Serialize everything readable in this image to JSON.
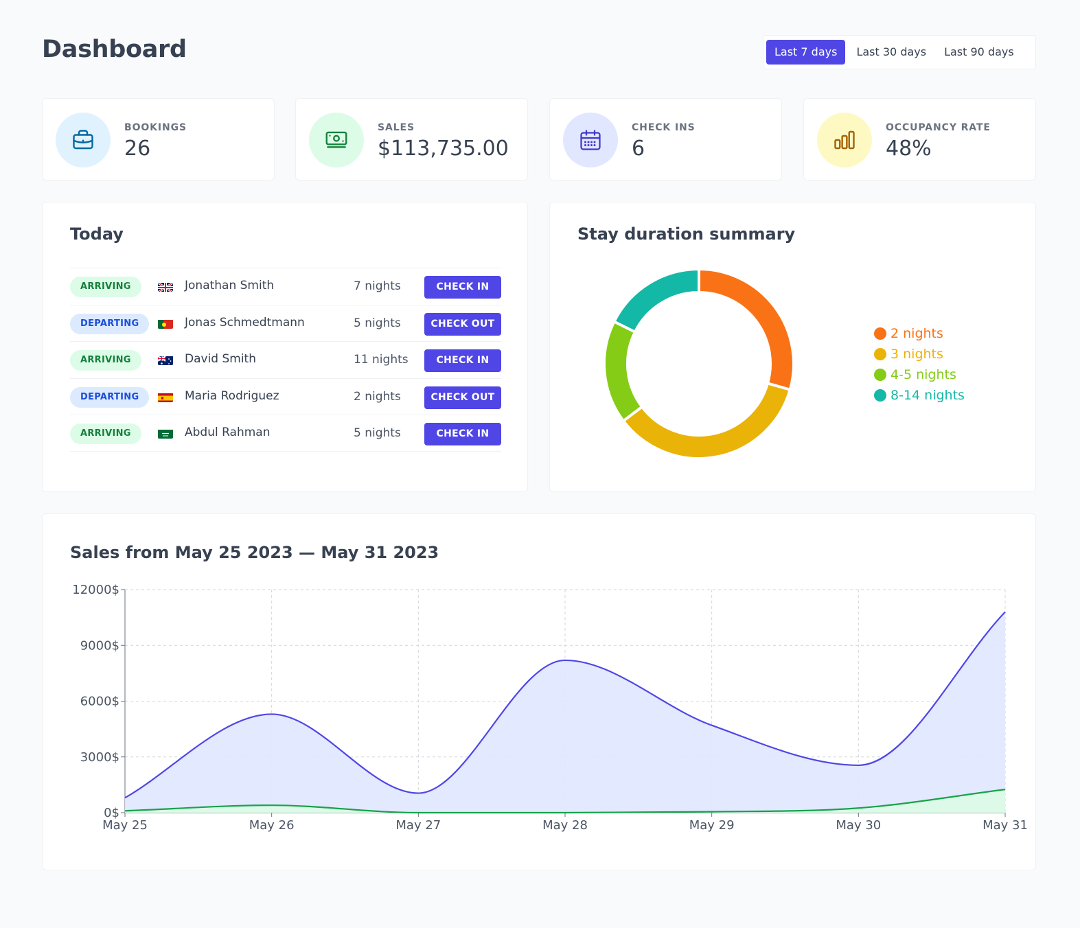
{
  "header": {
    "title": "Dashboard",
    "ranges": [
      "Last 7 days",
      "Last 30 days",
      "Last 90 days"
    ],
    "selected_range": "Last 7 days"
  },
  "stats": [
    {
      "label": "BOOKINGS",
      "value": "26",
      "icon": "briefcase-icon",
      "bg": "#e0f2fe",
      "color": "#0369a1"
    },
    {
      "label": "SALES",
      "value": "$113,735.00",
      "icon": "banknote-icon",
      "bg": "#dcfce7",
      "color": "#15803d"
    },
    {
      "label": "CHECK INS",
      "value": "6",
      "icon": "calendar-icon",
      "bg": "#e0e7ff",
      "color": "#4338ca"
    },
    {
      "label": "OCCUPANCY RATE",
      "value": "48%",
      "icon": "bar-chart-icon",
      "bg": "#fef9c3",
      "color": "#a16207"
    }
  ],
  "today": {
    "title": "Today",
    "rows": [
      {
        "status": "ARRIVING",
        "status_type": "arriving",
        "flag": "uk-flag-icon",
        "name": "Jonathan Smith",
        "nights": "7 nights",
        "action": "CHECK IN"
      },
      {
        "status": "DEPARTING",
        "status_type": "departing",
        "flag": "portugal-flag-icon",
        "name": "Jonas Schmedtmann",
        "nights": "5 nights",
        "action": "CHECK OUT"
      },
      {
        "status": "ARRIVING",
        "status_type": "arriving",
        "flag": "australia-flag-icon",
        "name": "David Smith",
        "nights": "11 nights",
        "action": "CHECK IN"
      },
      {
        "status": "DEPARTING",
        "status_type": "departing",
        "flag": "spain-flag-icon",
        "name": "Maria Rodriguez",
        "nights": "2 nights",
        "action": "CHECK OUT"
      },
      {
        "status": "ARRIVING",
        "status_type": "arriving",
        "flag": "saudi-arabia-flag-icon",
        "name": "Abdul Rahman",
        "nights": "5 nights",
        "action": "CHECK IN"
      }
    ]
  },
  "stay_summary": {
    "title": "Stay duration summary",
    "chart_data": {
      "type": "pie",
      "categories": [
        "2 nights",
        "3 nights",
        "4-5 nights",
        "8-14 nights"
      ],
      "values": [
        5,
        6,
        3,
        3
      ],
      "colors": [
        "#f97316",
        "#eab308",
        "#84cc16",
        "#14b8a6"
      ],
      "legend": "right"
    }
  },
  "sales": {
    "title": "Sales from May 25 2023 — May 31 2023",
    "chart_data": {
      "type": "area",
      "categories": [
        "May 25",
        "May 26",
        "May 27",
        "May 28",
        "May 29",
        "May 30",
        "May 31"
      ],
      "series": [
        {
          "values": [
            800,
            5300,
            1050,
            8200,
            4700,
            2550,
            10800
          ],
          "color": "#4f46e5",
          "fill": "#e0e7ff"
        },
        {
          "values": [
            100,
            400,
            0,
            0,
            50,
            250,
            1250
          ],
          "color": "#16a34a",
          "fill": "#dcfce7"
        }
      ],
      "y_ticks": [
        "0$",
        "3000$",
        "6000$",
        "9000$",
        "12000$"
      ],
      "ylim": [
        0,
        12000
      ],
      "grid": true
    }
  }
}
